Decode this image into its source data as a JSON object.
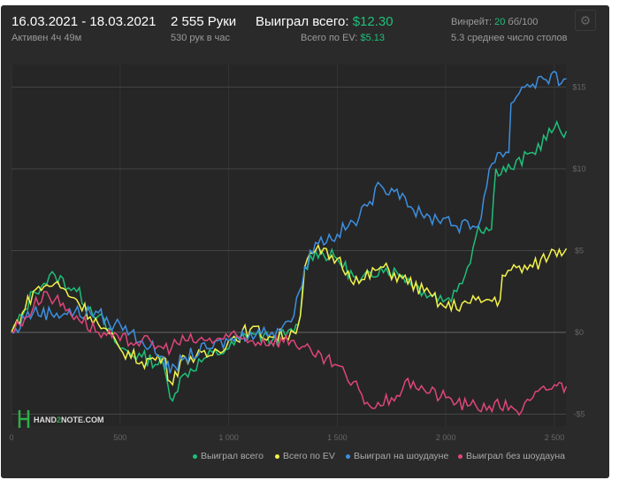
{
  "header": {
    "date_range": "16.03.2021 - 18.03.2021",
    "active": "Активен 4ч 49м",
    "hands": "2 555 Руки",
    "hands_per_hour": "530 рук в час",
    "won_label": "Выиграл всего:",
    "won_value": "$12.30",
    "ev_label": "Всего по EV:",
    "ev_value": "$5.13",
    "winrate_label": "Винрейт:",
    "winrate_value": "20",
    "winrate_unit": "бб/100",
    "avg_tables": "5.3 среднее число столов"
  },
  "logo": {
    "text_a": "HAND",
    "text_b": "2",
    "text_c": "NOTE.COM"
  },
  "chart_data": {
    "type": "line",
    "xlabel": "",
    "ylabel": "",
    "xlim": [
      0,
      2555
    ],
    "ylim": [
      -5.6,
      16.5
    ],
    "x_ticks": [
      0,
      500,
      1000,
      1500,
      2000,
      2500
    ],
    "x_tick_labels": [
      "0",
      "500",
      "1 000",
      "1 500",
      "2 000",
      "2 500"
    ],
    "y_ticks": [
      15,
      10,
      5,
      0,
      -5
    ],
    "y_tick_labels": [
      "$15",
      "$10",
      "$5",
      "$0",
      "-$5"
    ],
    "legend_position": "bottom-right",
    "grid": true,
    "series": [
      {
        "name": "Выиграл всего",
        "color": "#1fbf7a",
        "points": [
          [
            0,
            0
          ],
          [
            50,
            1
          ],
          [
            100,
            2.5
          ],
          [
            150,
            3
          ],
          [
            200,
            3.5
          ],
          [
            300,
            2.5
          ],
          [
            400,
            1
          ],
          [
            500,
            -1
          ],
          [
            600,
            -1.5
          ],
          [
            700,
            -2
          ],
          [
            730,
            -4
          ],
          [
            800,
            -2.5
          ],
          [
            900,
            -1.5
          ],
          [
            1000,
            -1
          ],
          [
            1100,
            0
          ],
          [
            1200,
            -0.5
          ],
          [
            1300,
            0
          ],
          [
            1330,
            1
          ],
          [
            1350,
            4
          ],
          [
            1400,
            5
          ],
          [
            1500,
            4.5
          ],
          [
            1600,
            3
          ],
          [
            1700,
            4
          ],
          [
            1800,
            3.5
          ],
          [
            1900,
            2.5
          ],
          [
            2000,
            2
          ],
          [
            2050,
            2.5
          ],
          [
            2100,
            4
          ],
          [
            2150,
            6.5
          ],
          [
            2210,
            6.3
          ],
          [
            2230,
            10
          ],
          [
            2300,
            10
          ],
          [
            2400,
            11
          ],
          [
            2500,
            12.5
          ],
          [
            2555,
            12.3
          ]
        ]
      },
      {
        "name": "Всего по EV",
        "color": "#f2f24a",
        "points": [
          [
            0,
            0
          ],
          [
            50,
            1.2
          ],
          [
            100,
            2.5
          ],
          [
            150,
            2.8
          ],
          [
            200,
            3
          ],
          [
            300,
            2
          ],
          [
            400,
            0.5
          ],
          [
            500,
            -1
          ],
          [
            600,
            -1.8
          ],
          [
            700,
            -1.5
          ],
          [
            730,
            -3
          ],
          [
            800,
            -1.5
          ],
          [
            900,
            -1.5
          ],
          [
            1000,
            -0.5
          ],
          [
            1100,
            0.2
          ],
          [
            1200,
            -0.3
          ],
          [
            1300,
            0
          ],
          [
            1330,
            1
          ],
          [
            1350,
            4
          ],
          [
            1400,
            5
          ],
          [
            1500,
            4.5
          ],
          [
            1600,
            3
          ],
          [
            1700,
            4
          ],
          [
            1800,
            3.3
          ],
          [
            1900,
            2.5
          ],
          [
            2000,
            1.5
          ],
          [
            2100,
            1.8
          ],
          [
            2200,
            2
          ],
          [
            2250,
            2
          ],
          [
            2260,
            3.5
          ],
          [
            2300,
            3.8
          ],
          [
            2400,
            4
          ],
          [
            2500,
            5
          ],
          [
            2555,
            5.13
          ]
        ]
      },
      {
        "name": "Выиграл на шоудауне",
        "color": "#3d8fe0",
        "points": [
          [
            0,
            0
          ],
          [
            30,
            0
          ],
          [
            50,
            1
          ],
          [
            100,
            1.2
          ],
          [
            400,
            1.2
          ],
          [
            450,
            0.5
          ],
          [
            500,
            0.5
          ],
          [
            550,
            0
          ],
          [
            600,
            -0.5
          ],
          [
            700,
            -1.5
          ],
          [
            730,
            -2.5
          ],
          [
            800,
            -1.5
          ],
          [
            900,
            -1
          ],
          [
            1000,
            -0.5
          ],
          [
            1100,
            0
          ],
          [
            1200,
            0
          ],
          [
            1300,
            1
          ],
          [
            1350,
            4
          ],
          [
            1400,
            5.5
          ],
          [
            1500,
            6
          ],
          [
            1600,
            7
          ],
          [
            1650,
            8
          ],
          [
            1700,
            9
          ],
          [
            1750,
            8.8
          ],
          [
            1800,
            8.5
          ],
          [
            1850,
            7.5
          ],
          [
            1900,
            7
          ],
          [
            2000,
            7
          ],
          [
            2050,
            6.5
          ],
          [
            2150,
            6.5
          ],
          [
            2200,
            10
          ],
          [
            2250,
            11
          ],
          [
            2290,
            11
          ],
          [
            2300,
            14
          ],
          [
            2350,
            15
          ],
          [
            2450,
            15.5
          ],
          [
            2555,
            15.5
          ]
        ]
      },
      {
        "name": "Выиграл без шоудауна",
        "color": "#e0457a",
        "points": [
          [
            0,
            0
          ],
          [
            100,
            1.5
          ],
          [
            150,
            2.5
          ],
          [
            200,
            2
          ],
          [
            300,
            1
          ],
          [
            400,
            0
          ],
          [
            500,
            -0.5
          ],
          [
            600,
            -0.5
          ],
          [
            700,
            -1
          ],
          [
            800,
            -0.5
          ],
          [
            900,
            -0.5
          ],
          [
            1000,
            -0.3
          ],
          [
            1100,
            -0.5
          ],
          [
            1300,
            -0.5
          ],
          [
            1400,
            -1.5
          ],
          [
            1500,
            -2
          ],
          [
            1550,
            -3
          ],
          [
            1600,
            -3.5
          ],
          [
            1650,
            -4.5
          ],
          [
            1700,
            -4.5
          ],
          [
            1750,
            -4
          ],
          [
            1800,
            -3.5
          ],
          [
            1850,
            -3
          ],
          [
            1900,
            -3.5
          ],
          [
            2000,
            -4
          ],
          [
            2100,
            -4.5
          ],
          [
            2200,
            -4.5
          ],
          [
            2300,
            -4.5
          ],
          [
            2350,
            -4.8
          ],
          [
            2400,
            -4
          ],
          [
            2500,
            -3.2
          ],
          [
            2555,
            -3.3
          ]
        ]
      }
    ]
  }
}
